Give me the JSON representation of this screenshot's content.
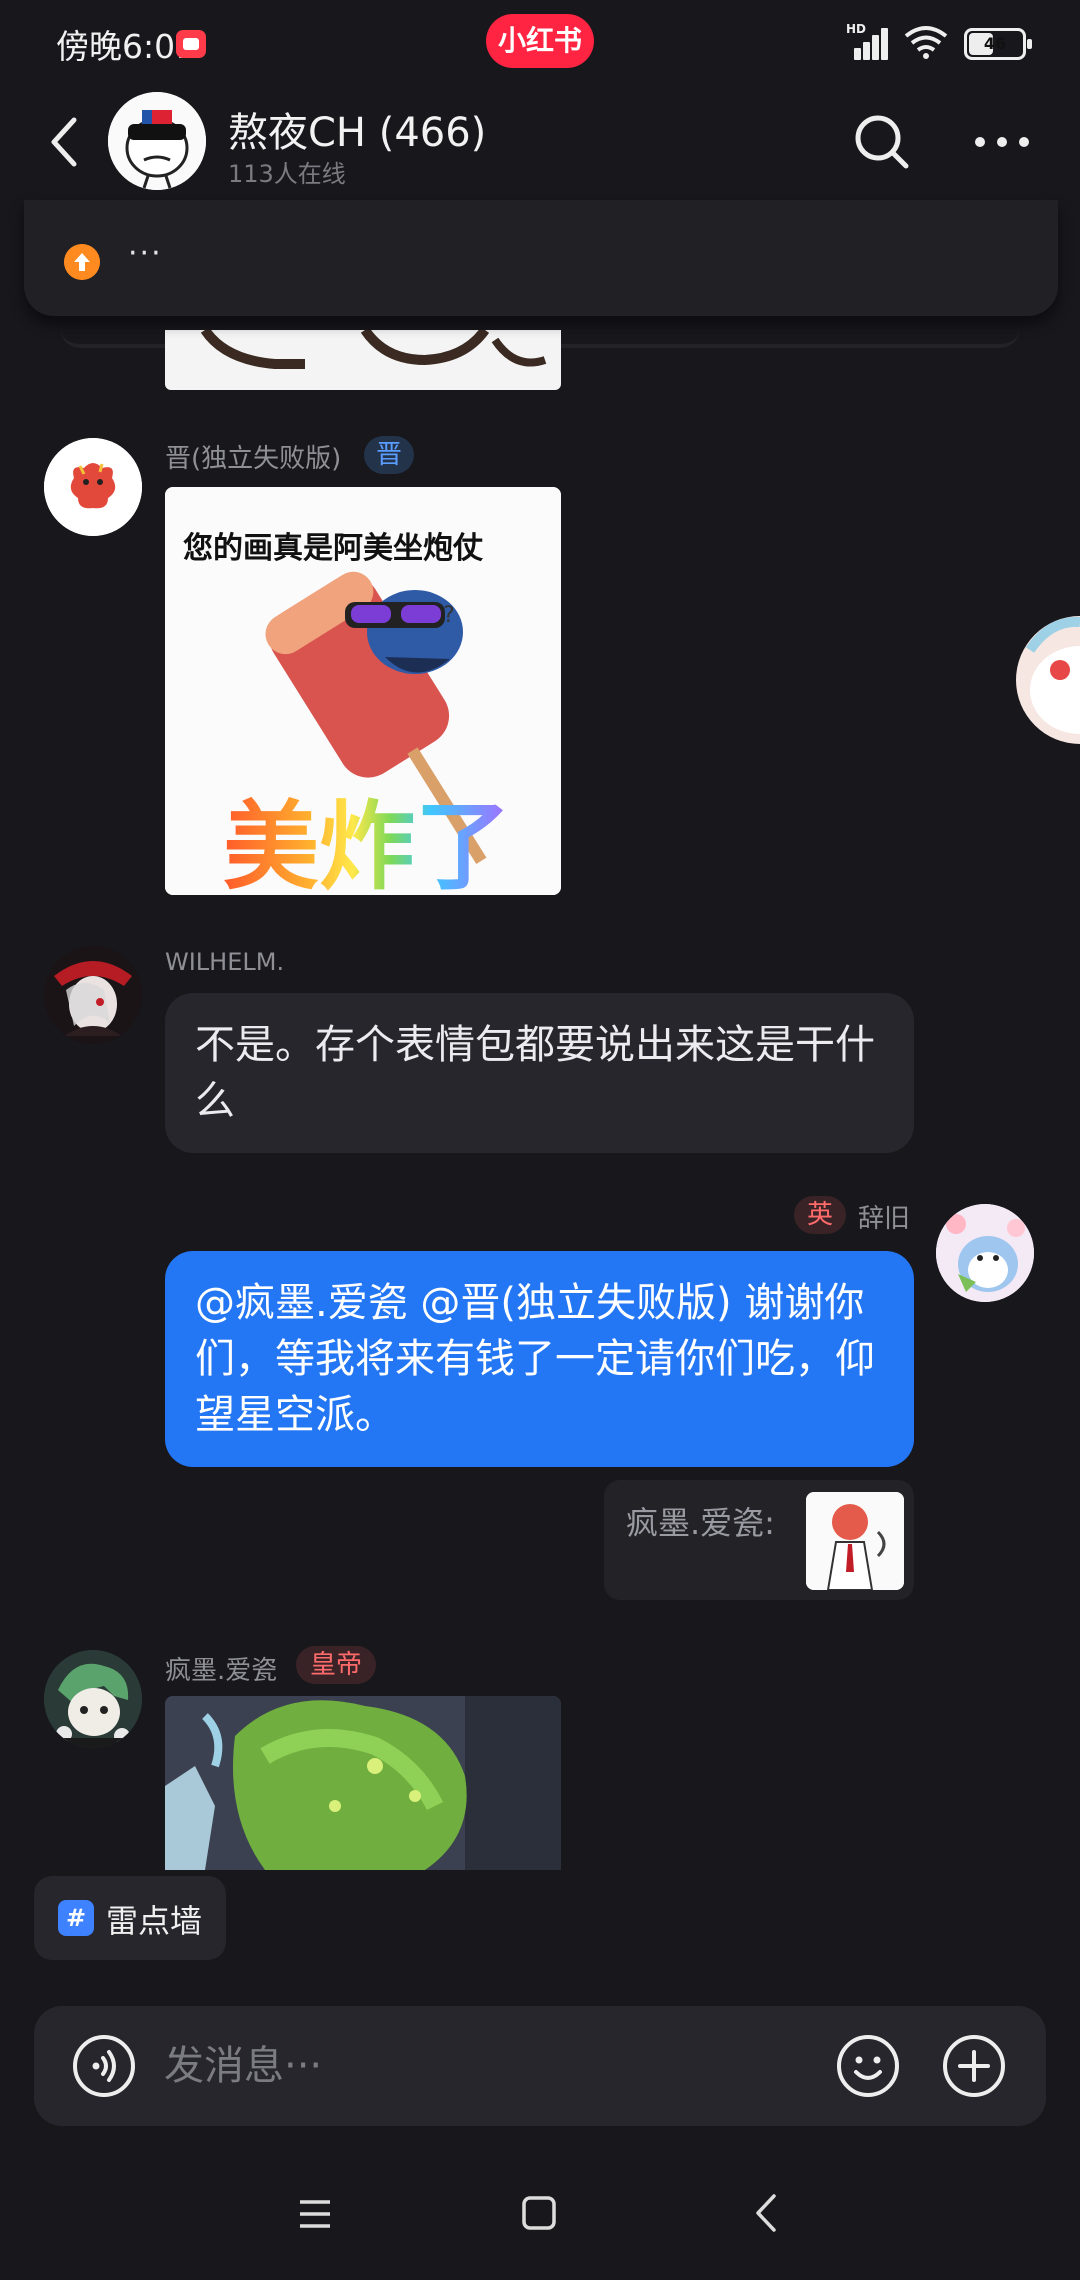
{
  "status_bar": {
    "time": "傍晚6:01",
    "brand_pill": "小红书",
    "network": "HD",
    "battery_text": "46",
    "battery_level": 0.46
  },
  "header": {
    "title": "熬夜CH (466)",
    "subtitle": "113人在线"
  },
  "pinned": {
    "text": "···"
  },
  "messages": [
    {
      "sender": "晋(独立失败版)",
      "badge": "晋",
      "image_caption_top": "您的画真是阿美坐炮仗",
      "image_caption_big": "美炸了"
    },
    {
      "sender": "WILHELM.",
      "text": "不是。存个表情包都要说出来这是干什么"
    },
    {
      "sender": "辞旧",
      "badge": "英",
      "text": "@疯墨.爱瓷 @晋(独立失败版) 谢谢你们，等我将来有钱了一定请你们吃，仰望星空派。",
      "quote": "疯墨.爱瓷:"
    },
    {
      "sender": "疯墨.爱瓷",
      "badge": "皇帝"
    }
  ],
  "topic_chip": {
    "icon": "#",
    "label": "雷点墙"
  },
  "input": {
    "placeholder": "发消息···"
  },
  "colors": {
    "background": "#17171c",
    "bubble_other": "#26262c",
    "bubble_self": "#2477f4",
    "brand": "#ff2442"
  }
}
